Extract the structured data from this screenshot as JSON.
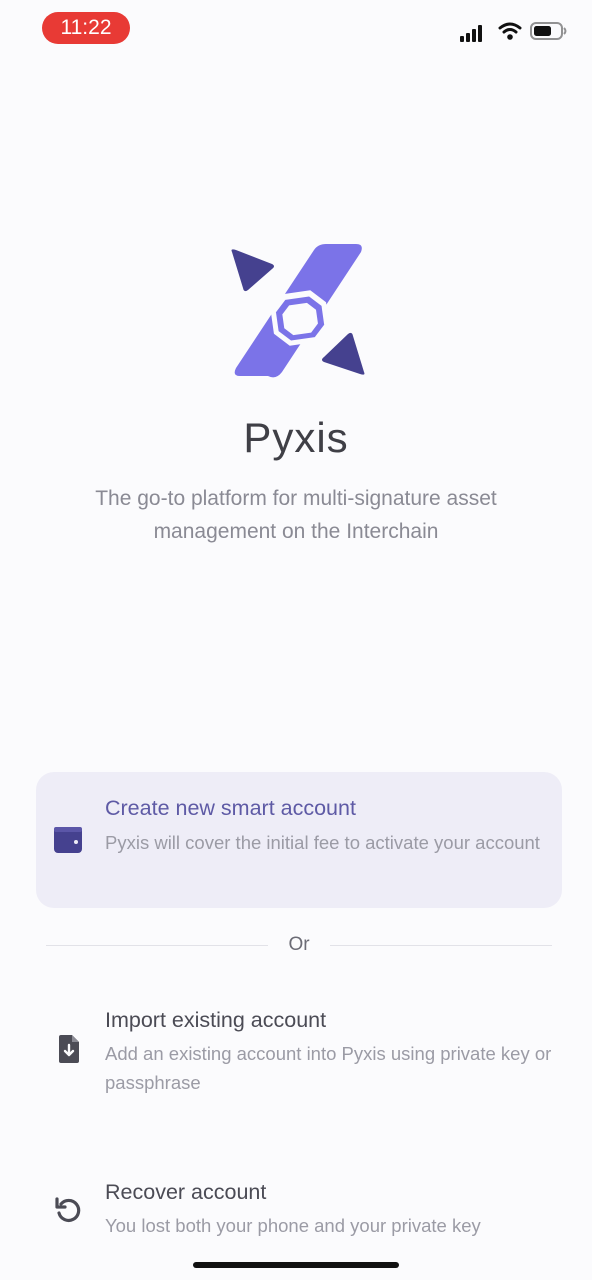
{
  "status_bar": {
    "time": "11:22",
    "icons": [
      "signal-icon",
      "wifi-icon",
      "battery-icon"
    ],
    "time_pill_color": "#e83a35"
  },
  "brand": {
    "app_name": "Pyxis",
    "tagline": "The go-to platform for multi-signature asset management on the Interchain",
    "logo_icon": "pyxis-compass-logo",
    "colors": {
      "primary": "#7b73e8",
      "dark": "#45418f"
    }
  },
  "options": [
    {
      "icon": "wallet-icon",
      "title": "Create new smart account",
      "description": "Pyxis will cover the initial fee to activate your account",
      "highlighted": true
    },
    {
      "icon": "file-download-icon",
      "title": "Import existing account",
      "description": "Add an existing account into Pyxis using private key or passphrase",
      "highlighted": false
    },
    {
      "icon": "recover-icon",
      "title": "Recover account",
      "description": "You lost both your phone and your private key",
      "highlighted": false
    }
  ],
  "divider": {
    "label": "Or"
  }
}
